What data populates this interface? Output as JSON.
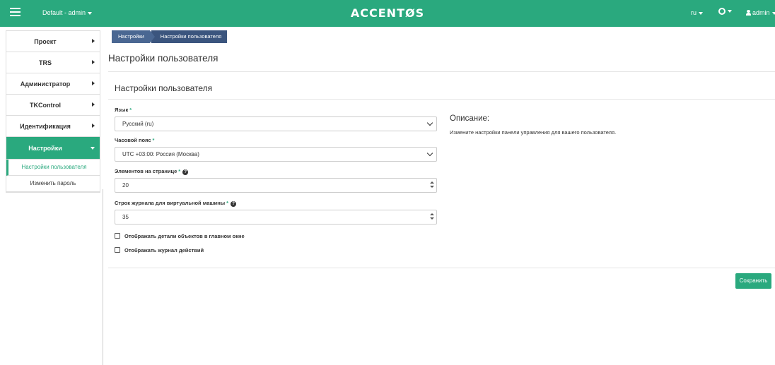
{
  "topbar": {
    "project_selector": "Default - admin",
    "brand": "ACCENTØS",
    "language": "ru",
    "user": "admin",
    "bg_color": "#2aa97e"
  },
  "sidebar": {
    "items": [
      {
        "label": "Проект"
      },
      {
        "label": "TRS"
      },
      {
        "label": "Администратор"
      },
      {
        "label": "TKControl"
      },
      {
        "label": "Идентификация"
      },
      {
        "label": "Настройки"
      }
    ],
    "subitems": [
      {
        "label": "Настройки пользователя"
      },
      {
        "label": "Изменить пароль"
      }
    ]
  },
  "breadcrumb": {
    "items": [
      "Настройки",
      "Настройки пользователя"
    ]
  },
  "page": {
    "title": "Настройки пользователя",
    "section_title": "Настройки пользователя"
  },
  "form": {
    "language": {
      "label": "Язык",
      "value": "Русский (ru)"
    },
    "timezone": {
      "label": "Часовой пояс",
      "value": "UTC +03:00: Россия (Москва)"
    },
    "page_size": {
      "label": "Элементов на странице",
      "value": "20"
    },
    "log_lines": {
      "label": "Строк журнала для виртуальной машины",
      "value": "35"
    },
    "checkbox_details": {
      "label": "Отображать детали объектов в главном окне",
      "checked": false
    },
    "checkbox_log": {
      "label": "Отображать журнал действий",
      "checked": false
    },
    "required_mark": "*",
    "help_mark": "?"
  },
  "description": {
    "title": "Описание:",
    "text": "Измените настройки панели управления для вашего пользователя."
  },
  "actions": {
    "save_label": "Сохранить"
  },
  "colors": {
    "accent": "#2aa97e",
    "breadcrumb": "#4a6792"
  }
}
